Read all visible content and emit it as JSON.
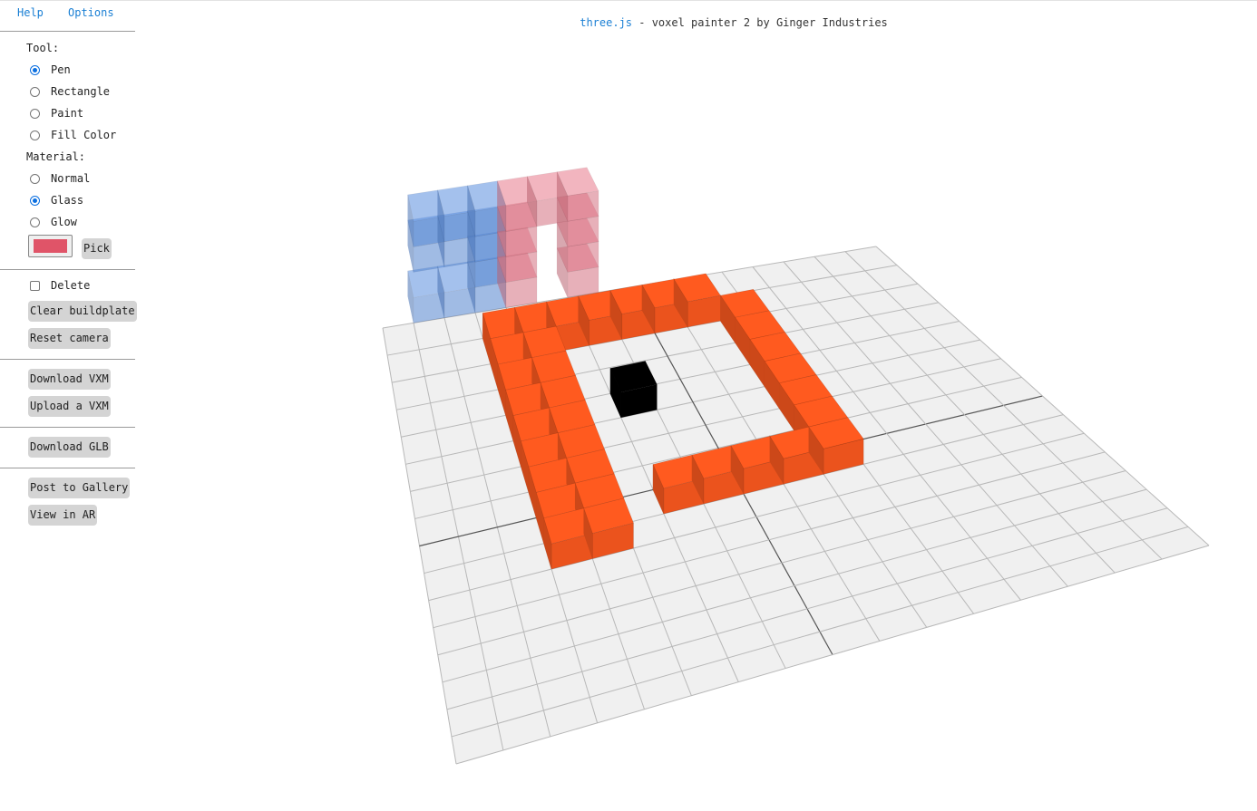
{
  "menu": {
    "help": "Help",
    "options": "Options"
  },
  "title": {
    "link": "three.js",
    "rest": " - voxel painter 2 by Ginger Industries"
  },
  "tool": {
    "label": "Tool:",
    "options": [
      "Pen",
      "Rectangle",
      "Paint",
      "Fill Color"
    ],
    "selected": "Pen"
  },
  "material": {
    "label": "Material:",
    "options": [
      "Normal",
      "Glass",
      "Glow"
    ],
    "selected": "Glass"
  },
  "color": {
    "value": "#e05468",
    "pick_label": "Pick"
  },
  "delete_label": "Delete",
  "buttons": {
    "clear": "Clear buildplate",
    "reset": "Reset camera",
    "download_vxm": "Download VXM",
    "upload_vxm": "Upload a VXM",
    "download_glb": "Download GLB",
    "post_gallery": "Post to Gallery",
    "view_ar": "View in AR"
  },
  "scene": {
    "grid_size": 16,
    "colors": {
      "orange": "#ff5a1f",
      "black": "#000000",
      "blue": "#5b8fe0",
      "pink": "#e87a8c",
      "grid_fill": "#f0f0f0",
      "grid_line": "#b8b8b8"
    }
  }
}
